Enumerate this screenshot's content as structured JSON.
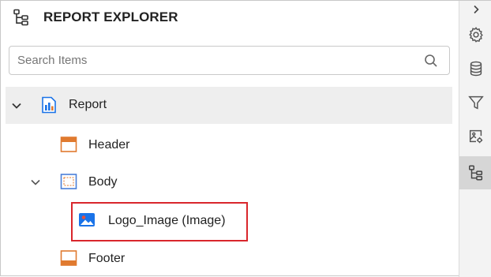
{
  "panel": {
    "title": "REPORT EXPLORER",
    "title_icon": "tree-structure-icon"
  },
  "search": {
    "placeholder": "Search Items",
    "value": "",
    "icon": "search-icon"
  },
  "tree": {
    "items": [
      {
        "label": "Report",
        "icon": "report-icon",
        "expanded": true,
        "selected": true
      },
      {
        "label": "Header",
        "icon": "header-section-icon"
      },
      {
        "label": "Body",
        "icon": "body-section-icon",
        "expanded": true
      },
      {
        "label": "Logo_Image (Image)",
        "icon": "image-icon",
        "highlighted": true
      },
      {
        "label": "Footer",
        "icon": "footer-section-icon"
      }
    ]
  },
  "toolbar": {
    "items": [
      {
        "icon": "chevron-right-icon"
      },
      {
        "icon": "gear-icon"
      },
      {
        "icon": "database-icon"
      },
      {
        "icon": "filter-icon"
      },
      {
        "icon": "image-settings-icon"
      },
      {
        "icon": "tree-structure-icon",
        "active": true
      }
    ]
  },
  "colors": {
    "accent_blue": "#1a73e8",
    "section_orange": "#e07a2f",
    "highlight_red": "#d9262c",
    "selected_bg": "#eeeeee",
    "toolbar_active_bg": "#d6d6d6"
  }
}
